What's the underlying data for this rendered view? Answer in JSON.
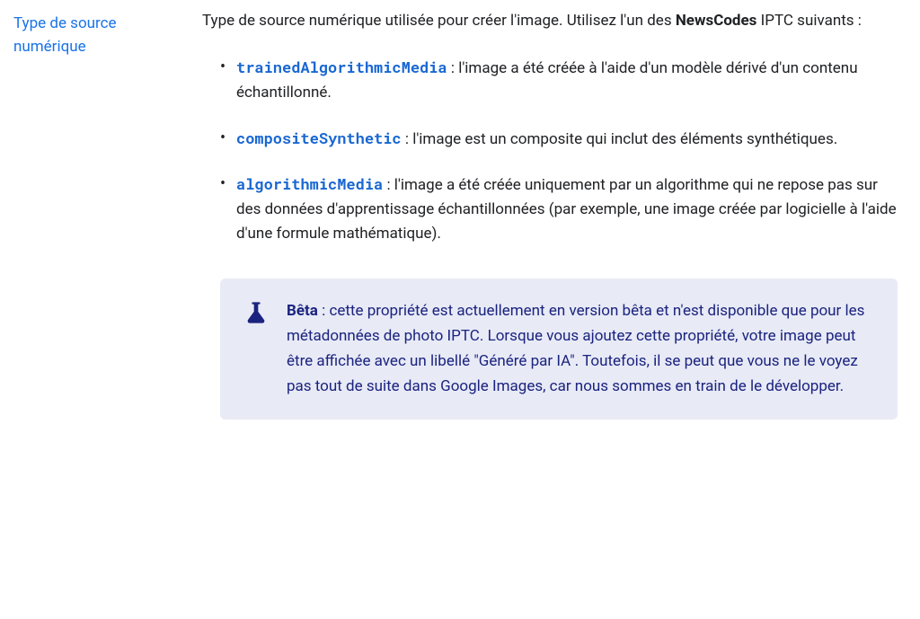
{
  "property": {
    "name": "Type de source numérique"
  },
  "description": {
    "text_before_bold": "Type de source numérique utilisée pour créer l'image. Utilisez l'un des ",
    "bold_term": "NewsCodes",
    "text_after_bold": " IPTC suivants :"
  },
  "values": [
    {
      "code": "trainedAlgorithmicMedia",
      "desc": " : l'image a été créée à l'aide d'un modèle dérivé d'un contenu échantillonné."
    },
    {
      "code": "compositeSynthetic",
      "desc": " : l'image est un composite qui inclut des éléments synthétiques."
    },
    {
      "code": "algorithmicMedia",
      "desc": " : l'image a été créée uniquement par un algorithme qui ne repose pas sur des données d'apprentissage échantillonnées (par exemple, une image créée par logicielle à l'aide d'une formule mathématique)."
    }
  ],
  "callout": {
    "label": "Bêta",
    "text": " : cette propriété est actuellement en version bêta et n'est disponible que pour les métadonnées de photo IPTC. Lorsque vous ajoutez cette propriété, votre image peut être affichée avec un libellé \"Généré par IA\". Toutefois, il se peut que vous ne le voyez pas tout de suite dans Google Images, car nous sommes en train de le développer."
  }
}
